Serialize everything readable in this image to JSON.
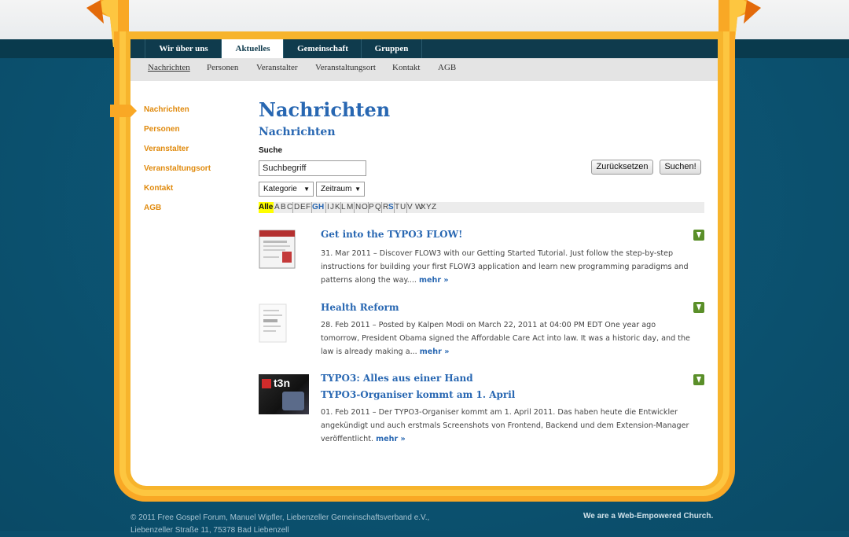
{
  "nav": {
    "main": [
      {
        "label": "Wir über uns"
      },
      {
        "label": "Aktuelles"
      },
      {
        "label": "Gemeinschaft"
      },
      {
        "label": "Gruppen"
      }
    ],
    "sub": [
      {
        "label": "Nachrichten"
      },
      {
        "label": "Personen"
      },
      {
        "label": "Veranstalter"
      },
      {
        "label": "Veranstaltungsort"
      },
      {
        "label": "Kontakt"
      },
      {
        "label": "AGB"
      }
    ]
  },
  "sidebar": {
    "items": [
      {
        "label": "Nachrichten"
      },
      {
        "label": "Personen"
      },
      {
        "label": "Veranstalter"
      },
      {
        "label": "Veranstaltungsort"
      },
      {
        "label": "Kontakt"
      },
      {
        "label": "AGB"
      }
    ]
  },
  "main": {
    "title": "Nachrichten",
    "subtitle": "Nachrichten",
    "search": {
      "label": "Suche",
      "value": "Suchbegriff",
      "reset_label": "Zurücksetzen",
      "submit_label": "Suchen!"
    },
    "filters": {
      "category": "Kategorie",
      "period": "Zeitraum"
    },
    "alphabet": [
      "Alle",
      "A",
      "B",
      "C",
      "D",
      "E",
      "F",
      "G",
      "H",
      "I",
      "J",
      "K",
      "L",
      "M",
      "N",
      "O",
      "P",
      "Q",
      "R",
      "S",
      "T",
      "U",
      "V",
      "W",
      "X",
      "Y",
      "Z"
    ]
  },
  "news": [
    {
      "title": "Get into the TYPO3 FLOW!",
      "teaser": "31. Mar 2011 – Discover FLOW3 with our Getting Started Tutorial. Just follow the step-by-step instructions for building your first FLOW3 application and learn new programming paradigms and patterns along the way....",
      "more": "mehr »"
    },
    {
      "title": "Health Reform",
      "teaser": "28. Feb 2011 – Posted by Kalpen Modi on March 22, 2011 at 04:00 PM EDT One year ago tomorrow, President Obama signed the Affordable Care Act into law. It was a historic day, and the law is already making a...",
      "more": "mehr »"
    },
    {
      "title": "TYPO3: Alles aus einer Hand",
      "title2": "TYPO3-Organiser kommt am 1. April",
      "teaser": "01. Feb 2011 – Der TYPO3-Organiser kommt am 1. April 2011. Das haben heute die Entwickler angekündigt und auch erstmals Screenshots von Frontend, Backend und dem Extension-Manager veröffentlicht.",
      "more": "mehr »",
      "thumb_text": "t3n"
    }
  ],
  "footer": {
    "line1": "© 2011 Free Gospel Forum, Manuel Wipfler, Liebenzeller Gemeinschaftsverband e.V.,",
    "line2": "Liebenzeller Straße 11, 75378 Bad Liebenzell",
    "tagline": "We are a Web-Empowered Church."
  },
  "colors": {
    "accent": "#2867b2",
    "sidebar": "#e08a0d",
    "frame": "#f9a825",
    "nav": "#0f3b4d"
  }
}
